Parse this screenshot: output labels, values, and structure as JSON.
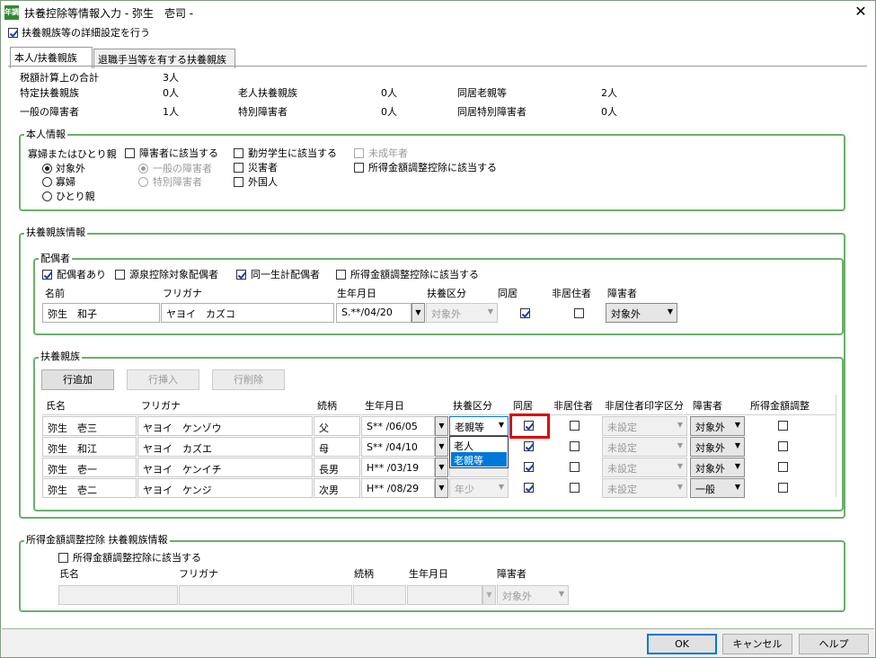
{
  "window": {
    "title": "扶養控除等情報入力 - 弥生　壱司 -",
    "icon_text": "年調",
    "close_symbol": "✕"
  },
  "detail_checkbox": {
    "label": "扶養親族等の詳細設定を行う",
    "checked": true
  },
  "tabs": [
    {
      "label": "本人/扶養親族",
      "active": true
    },
    {
      "label": "退職手当等を有する扶養親族",
      "active": false
    }
  ],
  "summary": {
    "tax_total_label": "税額計算上の合計",
    "tax_total_value": "3人",
    "specific_label": "特定扶養親族",
    "specific_value": "0人",
    "elderly_label": "老人扶養親族",
    "elderly_value": "0人",
    "cohabit_elderly_label": "同居老親等",
    "cohabit_elderly_value": "2人",
    "general_disabled_label": "一般の障害者",
    "general_disabled_value": "1人",
    "special_disabled_label": "特別障害者",
    "special_disabled_value": "0人",
    "cohabit_special_label": "同居特別障害者",
    "cohabit_special_value": "0人"
  },
  "self_info": {
    "group_title": "本人情報",
    "widow_label": "寡婦またはひとり親",
    "widow_options": [
      {
        "label": "対象外",
        "selected": true
      },
      {
        "label": "寡婦",
        "selected": false
      },
      {
        "label": "ひとり親",
        "selected": false
      }
    ],
    "disabled_checkbox": "障害者に該当する",
    "disabled_options": [
      {
        "label": "一般の障害者",
        "selected": true
      },
      {
        "label": "特別障害者",
        "selected": false
      }
    ],
    "student_checkbox": "勤労学生に該当する",
    "disaster_checkbox": "災害者",
    "foreigner_checkbox": "外国人",
    "minor_checkbox": "未成年者",
    "income_adj_checkbox": "所得金額調整控除に該当する"
  },
  "dependents_info": {
    "group_title": "扶養親族情報",
    "spouse": {
      "group_title": "配偶者",
      "has_spouse": {
        "label": "配偶者あり",
        "checked": true
      },
      "withholding": {
        "label": "源泉控除対象配偶者",
        "checked": false
      },
      "same_household": {
        "label": "同一生計配偶者",
        "checked": true
      },
      "income_adj": {
        "label": "所得金額調整控除に該当する",
        "checked": false
      },
      "headers": {
        "name": "名前",
        "kana": "フリガナ",
        "birth": "生年月日",
        "category": "扶養区分",
        "cohabit": "同居",
        "nonresident": "非居住者",
        "disability": "障害者"
      },
      "row": {
        "name": "弥生　和子",
        "kana": "ヤヨイ　カズコ",
        "birth": "S.**/04/20",
        "category": "対象外",
        "cohabit": true,
        "nonresident": false,
        "disability": "対象外"
      }
    },
    "family": {
      "group_title": "扶養親族",
      "buttons": {
        "add": "行追加",
        "insert": "行挿入",
        "delete": "行削除"
      },
      "headers": [
        "氏名",
        "フリガナ",
        "続柄",
        "生年月日",
        "扶養区分",
        "同居",
        "非居住者",
        "非居住者印字区分",
        "障害者",
        "所得金額調整"
      ],
      "rows": [
        {
          "name": "弥生　壱三",
          "kana": "ヤヨイ　ケンゾウ",
          "relation": "父",
          "birth": "S** /06/05",
          "category": "老親等",
          "cohabit": true,
          "nonresident": false,
          "print_class": "未設定",
          "disability": "対象外",
          "income_adj": false
        },
        {
          "name": "弥生　和江",
          "kana": "ヤヨイ　カズエ",
          "relation": "母",
          "birth": "S** /04/10",
          "category": "",
          "cohabit": true,
          "nonresident": false,
          "print_class": "未設定",
          "disability": "対象外",
          "income_adj": false
        },
        {
          "name": "弥生　壱一",
          "kana": "ヤヨイ　ケンイチ",
          "relation": "長男",
          "birth": "H** /03/19",
          "category": "",
          "cohabit": true,
          "nonresident": false,
          "print_class": "未設定",
          "disability": "対象外",
          "income_adj": false
        },
        {
          "name": "弥生　壱二",
          "kana": "ヤヨイ　ケンジ",
          "relation": "次男",
          "birth": "H** /08/29",
          "category": "年少",
          "cohabit": true,
          "nonresident": false,
          "print_class": "未設定",
          "disability": "一般",
          "income_adj": false
        }
      ],
      "dropdown_options": [
        {
          "label": "老人",
          "selected": false
        },
        {
          "label": "老親等",
          "selected": true
        }
      ]
    }
  },
  "income_adj_section": {
    "group_title": "所得金額調整控除 扶養親族情報",
    "checkbox": {
      "label": "所得金額調整控除に該当する",
      "checked": false
    },
    "headers": {
      "name": "氏名",
      "kana": "フリガナ",
      "relation": "続柄",
      "birth": "生年月日",
      "disability": "障害者"
    },
    "disability_value": "対象外"
  },
  "footer": {
    "ok": "OK",
    "cancel": "キャンセル",
    "help": "ヘルプ"
  }
}
